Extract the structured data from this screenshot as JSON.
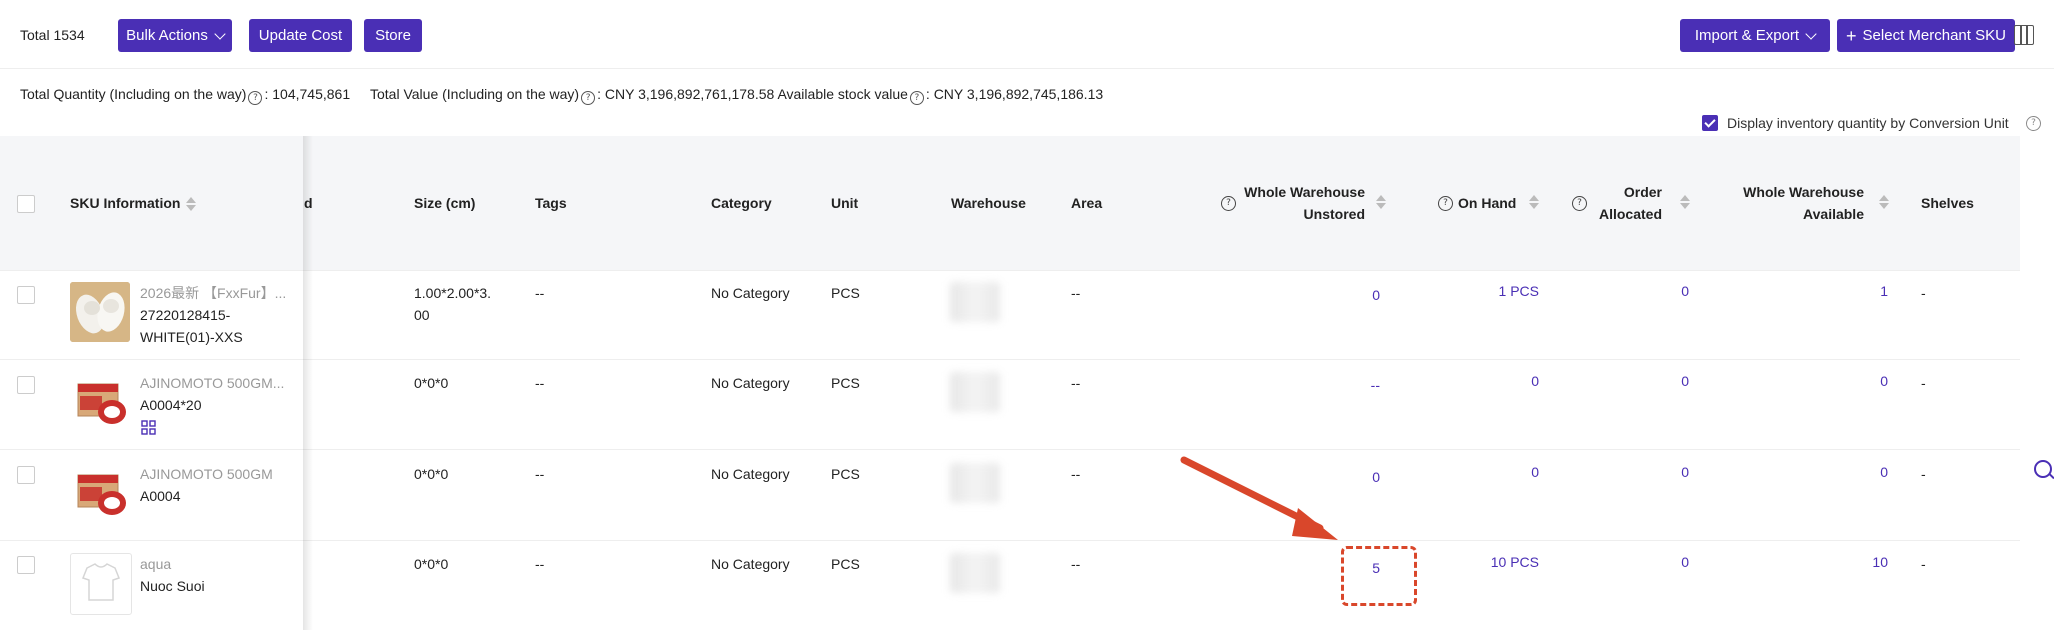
{
  "toolbar": {
    "total_label": "Total 1534",
    "bulk_actions": "Bulk Actions",
    "update_cost": "Update Cost",
    "store": "Store",
    "import_export": "Import & Export",
    "select_merchant_sku": "Select Merchant SKU"
  },
  "summary": {
    "total_quantity_label": "Total Quantity (Including on the way)",
    "total_quantity_value": ": 104,745,861",
    "total_value_label": "Total Value (Including on the way)",
    "total_value_value": ": CNY 3,196,892,761,178.58",
    "available_label": "Available stock value",
    "available_value": ": CNY 3,196,892,745,186.13"
  },
  "display_toggle": {
    "label": "Display inventory quantity by Conversion Unit",
    "checked": true
  },
  "columns": {
    "sku_info": "SKU Information",
    "partial": "d",
    "size": "Size (cm)",
    "tags": "Tags",
    "category": "Category",
    "unit": "Unit",
    "warehouse": "Warehouse",
    "area": "Area",
    "unstored_line1": "Whole Warehouse",
    "unstored_line2": "Unstored",
    "on_hand": "On Hand",
    "allocated_line1": "Order",
    "allocated_line2": "Allocated",
    "available_line1": "Whole Warehouse",
    "available_line2": "Available",
    "shelves": "Shelves"
  },
  "rows": [
    {
      "name": "2026最新 【FxxFur】...",
      "sku_line1": "27220128415-",
      "sku_line2": "WHITE(01)-XXS",
      "size_line1": "1.00*2.00*3.",
      "size_line2": "00",
      "tags": "--",
      "category": "No Category",
      "unit": "PCS",
      "area": "--",
      "unstored": "0",
      "on_hand": "1 PCS",
      "allocated": "0",
      "available": "1",
      "shelves": "-"
    },
    {
      "name": "AJINOMOTO 500GM...",
      "sku_line1": "A0004*20",
      "sku_line2": "",
      "size_line1": "0*0*0",
      "size_line2": "",
      "tags": "--",
      "category": "No Category",
      "unit": "PCS",
      "area": "--",
      "unstored": "--",
      "on_hand": "0",
      "allocated": "0",
      "available": "0",
      "shelves": "-"
    },
    {
      "name": "AJINOMOTO 500GM",
      "sku_line1": "A0004",
      "sku_line2": "",
      "size_line1": "0*0*0",
      "size_line2": "",
      "tags": "--",
      "category": "No Category",
      "unit": "PCS",
      "area": "--",
      "unstored": "0",
      "on_hand": "0",
      "allocated": "0",
      "available": "0",
      "shelves": "-"
    },
    {
      "name": "aqua",
      "sku_line1": "Nuoc Suoi",
      "sku_line2": "",
      "size_line1": "0*0*0",
      "size_line2": "",
      "tags": "--",
      "category": "No Category",
      "unit": "PCS",
      "area": "--",
      "unstored": "5",
      "on_hand": "10 PCS",
      "allocated": "0",
      "available": "10",
      "shelves": "-"
    }
  ],
  "colors": {
    "accent": "#4a2fb5",
    "annotation": "#d9472b"
  }
}
